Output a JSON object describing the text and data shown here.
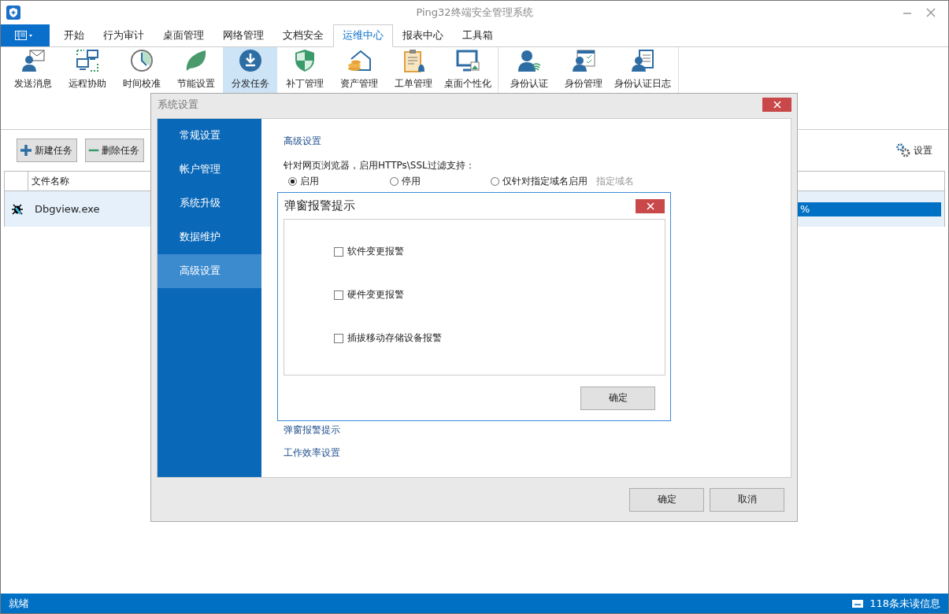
{
  "window": {
    "title": "Ping32终端安全管理系统"
  },
  "tabs": [
    {
      "label": "开始",
      "selected": false
    },
    {
      "label": "行为审计",
      "selected": false
    },
    {
      "label": "桌面管理",
      "selected": false
    },
    {
      "label": "网络管理",
      "selected": false
    },
    {
      "label": "文档安全",
      "selected": false
    },
    {
      "label": "运维中心",
      "selected": true
    },
    {
      "label": "报表中心",
      "selected": false
    },
    {
      "label": "工具箱",
      "selected": false
    }
  ],
  "ribbon": {
    "groups": [
      [
        {
          "label": "发送消息",
          "selected": false
        },
        {
          "label": "远程协助",
          "selected": false
        },
        {
          "label": "时间校准",
          "selected": false
        },
        {
          "label": "节能设置",
          "selected": false
        },
        {
          "label": "分发任务",
          "selected": true
        },
        {
          "label": "补丁管理",
          "selected": false
        },
        {
          "label": "资产管理",
          "selected": false
        },
        {
          "label": "工单管理",
          "selected": false
        },
        {
          "label": "桌面个性化",
          "selected": false
        }
      ],
      [
        {
          "label": "身份认证",
          "selected": false
        },
        {
          "label": "身份管理",
          "selected": false
        },
        {
          "label": "身份认证日志",
          "selected": false
        }
      ]
    ]
  },
  "toolbar": {
    "buttons": [
      {
        "kind": "add",
        "label": "新建任务"
      },
      {
        "kind": "remove",
        "label": "删除任务"
      }
    ],
    "settings": "设置"
  },
  "table": {
    "columns": [
      "文件名称"
    ],
    "rows": [
      {
        "name": "Dbgview.exe",
        "selected": true,
        "progress": {
          "text": "%",
          "level": 1
        }
      }
    ]
  },
  "settings_dialog": {
    "title": "系统设置",
    "nav": [
      {
        "label": "常规设置",
        "selected": false
      },
      {
        "label": "帐户管理",
        "selected": false
      },
      {
        "label": "系统升级",
        "selected": false
      },
      {
        "label": "数据维护",
        "selected": false
      },
      {
        "label": "高级设置",
        "selected": true
      }
    ],
    "section_title": "高级设置",
    "ssl_label": "针对网页浏览器，启用HTTPs\\SSL过滤支持：",
    "radios": [
      {
        "label": "启用",
        "selected": true
      },
      {
        "label": "停用",
        "selected": false
      },
      {
        "label": "仅针对指定域名启用",
        "selected": false
      }
    ],
    "domain_hint": "指定域名",
    "links": [
      "弹窗报警提示",
      "工作效率设置"
    ],
    "buttons": [
      "确定",
      "取消"
    ]
  },
  "alert_dialog": {
    "title": "弹窗报警提示",
    "options": [
      {
        "label": "软件变更报警",
        "checked": false
      },
      {
        "label": "硬件变更报警",
        "checked": false
      },
      {
        "label": "插拔移动存储设备报警",
        "checked": false
      }
    ],
    "button": "确定"
  },
  "status_bar": {
    "left": "就绪",
    "right": "118条未读信息"
  }
}
